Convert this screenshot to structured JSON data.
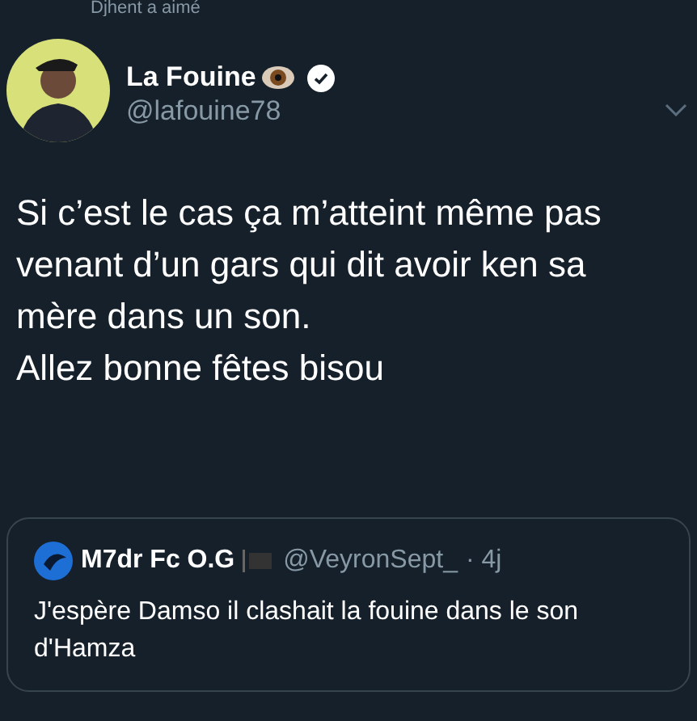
{
  "context": {
    "text": "Djhent a aimé"
  },
  "tweet": {
    "name": "La Fouine",
    "handle": "@lafouine78",
    "lines": [
      "Si c’est le cas ça m’atteint même pas venant d’un gars qui dit avoir ken sa mère dans un son.",
      "Allez bonne fêtes bisou"
    ]
  },
  "quote": {
    "name": "M7dr Fc O.G",
    "handle": "@VeyronSept_",
    "time": "· 4j",
    "text": "J'espère Damso il clashait la fouine dans le son d'Hamza"
  }
}
